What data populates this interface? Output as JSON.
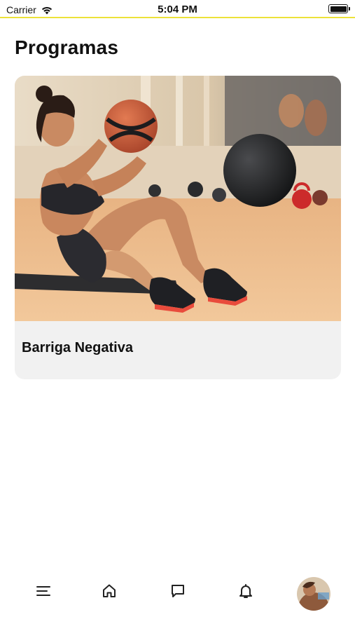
{
  "status_bar": {
    "carrier": "Carrier",
    "time": "5:04 PM",
    "accent_color": "#ece23a"
  },
  "header": {
    "title": "Programas"
  },
  "programs": [
    {
      "title": "Barriga Negativa",
      "image_icon": "workout-photo"
    }
  ],
  "tab_bar": {
    "items": [
      {
        "icon": "menu-icon"
      },
      {
        "icon": "home-icon"
      },
      {
        "icon": "chat-icon"
      },
      {
        "icon": "bell-icon"
      },
      {
        "icon": "avatar"
      }
    ]
  }
}
